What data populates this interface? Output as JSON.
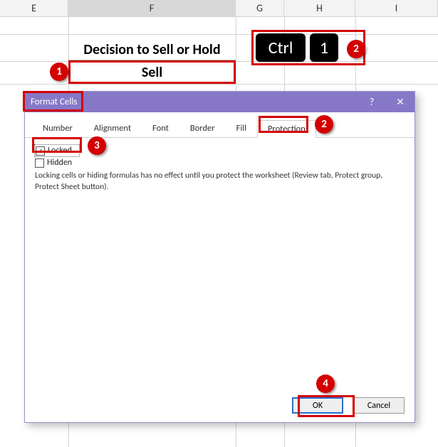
{
  "columns": {
    "E": "E",
    "F": "F",
    "G": "G",
    "H": "H",
    "I": "I"
  },
  "sheet": {
    "header_text": "Decision to Sell or Hold",
    "sell_text": "Sell"
  },
  "keys": {
    "ctrl": "Ctrl",
    "one": "1"
  },
  "callouts": {
    "c1": "1",
    "c2": "2",
    "c2b": "2",
    "c3": "3",
    "c4": "4"
  },
  "dialog": {
    "title": "Format Cells",
    "help": "?",
    "close": "✕",
    "tabs": {
      "number": "Number",
      "alignment": "Alignment",
      "font": "Font",
      "border": "Border",
      "fill": "Fill",
      "protection": "Protection"
    },
    "locked_label": "Locked",
    "hidden_label": "Hidden",
    "info": "Locking cells or hiding formulas has no effect until you protect the worksheet (Review tab, Protect group, Protect Sheet button).",
    "ok": "OK",
    "cancel": "Cancel",
    "locked_check": "✓"
  }
}
